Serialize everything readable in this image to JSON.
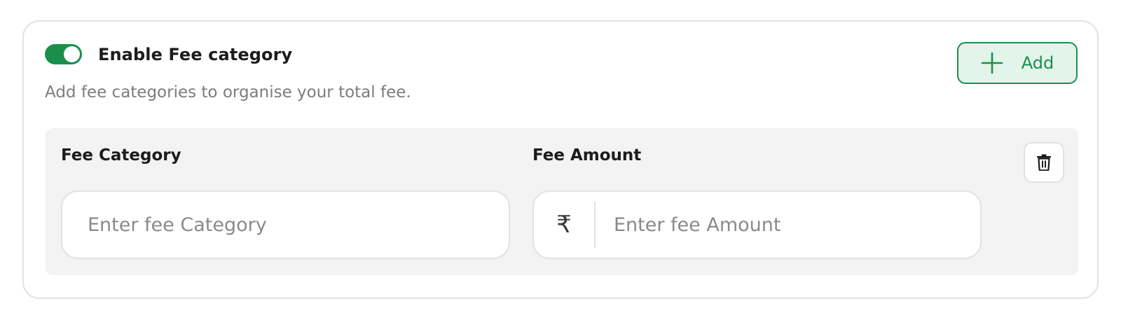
{
  "fee_category_section": {
    "toggle": {
      "state": "on",
      "label": "Enable Fee category",
      "color": "#1a8f4c"
    },
    "helper_text": "Add fee categories to organise your total fee.",
    "add_button": {
      "icon": "plus-icon",
      "label": "Add"
    },
    "row": {
      "category_label": "Fee Category",
      "category_placeholder": "Enter fee Category",
      "category_value": "",
      "amount_label": "Fee Amount",
      "currency_symbol": "₹",
      "amount_placeholder": "Enter fee Amount",
      "amount_value": "",
      "delete_icon": "trash-icon"
    }
  },
  "colors": {
    "accent": "#1a8f4c",
    "accent_bg": "#e3f4ea",
    "panel_bg": "#f3f3f3",
    "border": "#e2e2e2"
  }
}
